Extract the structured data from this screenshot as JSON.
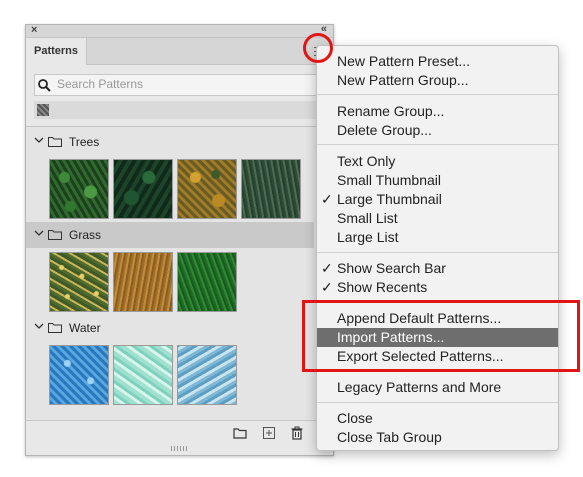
{
  "panel": {
    "close_glyph": "×",
    "collapse_glyph": "«",
    "tab_label": "Patterns",
    "search_placeholder": "Search Patterns",
    "groups": [
      {
        "label": "Trees",
        "expanded": true,
        "selected": false,
        "thumbs": [
          "Dark Fern Foliage",
          "Dark Conifer Canopy",
          "Autumn Forest",
          "Pine Forest"
        ]
      },
      {
        "label": "Grass",
        "expanded": true,
        "selected": true,
        "thumbs": [
          "Flowered Grass",
          "Dry Grass",
          "Green Grass"
        ]
      },
      {
        "label": "Water",
        "expanded": true,
        "selected": false,
        "thumbs": [
          "Pool Water",
          "Light Water Caustics",
          "Water Ripple"
        ]
      }
    ],
    "footer_icons": [
      "new-group-folder-icon",
      "new-pattern-icon",
      "delete-trash-icon"
    ]
  },
  "menu": {
    "items": [
      {
        "label": "New Pattern Preset...",
        "checked": false
      },
      {
        "label": "New Pattern Group...",
        "checked": false
      },
      {
        "label": "Rename Group...",
        "checked": false
      },
      {
        "label": "Delete Group...",
        "checked": false
      },
      {
        "label": "Text Only",
        "checked": false
      },
      {
        "label": "Small Thumbnail",
        "checked": false
      },
      {
        "label": "Large Thumbnail",
        "checked": true
      },
      {
        "label": "Small List",
        "checked": false
      },
      {
        "label": "Large List",
        "checked": false
      },
      {
        "label": "Show Search Bar",
        "checked": true
      },
      {
        "label": "Show Recents",
        "checked": true
      },
      {
        "label": "Append Default Patterns...",
        "checked": false
      },
      {
        "label": "Import Patterns...",
        "checked": false,
        "highlighted": true
      },
      {
        "label": "Export Selected Patterns...",
        "checked": false
      },
      {
        "label": "Legacy Patterns and More",
        "checked": false
      },
      {
        "label": "Close",
        "checked": false
      },
      {
        "label": "Close Tab Group",
        "checked": false
      }
    ],
    "check_glyph": "✓"
  },
  "colors": {
    "annotation_red": "#e21515",
    "menu_highlight": "#6e6e6e",
    "panel_bg": "#e8e8e8",
    "selected_group": "#c9c9c9"
  }
}
